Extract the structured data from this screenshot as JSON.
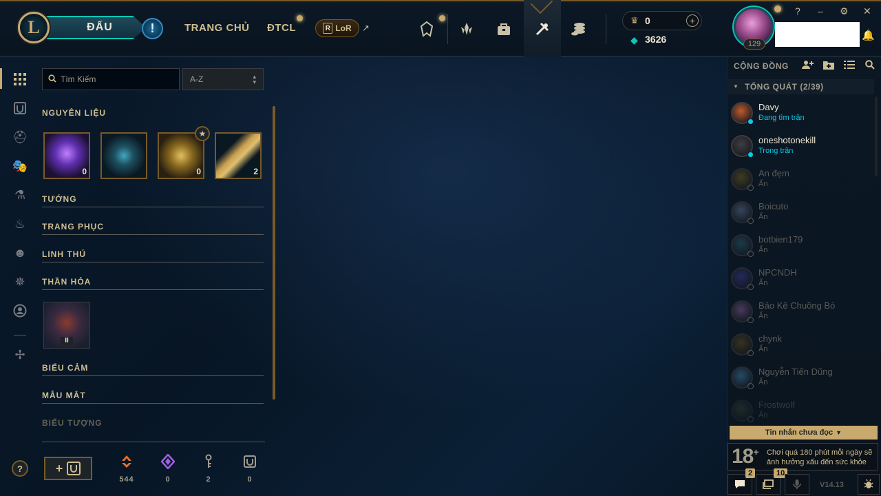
{
  "nav": {
    "play_label": "ĐẤU",
    "home_label": "TRANG CHỦ",
    "tft_label": "ĐTCL",
    "lor_label": "LoR",
    "lor_badge": "R",
    "external_arrow": "↗",
    "rp_value": "0",
    "be_value": "3626",
    "level": "129",
    "window": {
      "help": "?",
      "minimize": "–",
      "settings": "⚙",
      "close": "✕"
    },
    "icons": [
      "shop-crest-icon",
      "tft-icon",
      "collection-bag-icon",
      "loot-hextech-icon",
      "currency-stack-icon"
    ]
  },
  "rail": {
    "items": [
      "grid-icon",
      "champion-shield-icon",
      "helmet-icon",
      "mask-icon",
      "potion-icon",
      "flame-icon",
      "emote-smile-icon",
      "sparkle-icon",
      "profile-icon",
      "ward-icon"
    ],
    "help": "?"
  },
  "collection": {
    "search_placeholder": "Tìm Kiếm",
    "sort_label": "A-Z",
    "sections": {
      "materials": "NGUYÊN LIỆU",
      "champions": "TƯỚNG",
      "skins": "TRANG PHỤC",
      "companions": "LINH THÚ",
      "wards": "THẦN HỎA",
      "emotes": "BIỂU CẢM",
      "eyes": "MẪU MẮT",
      "icons": "BIỂU TƯỢNG"
    },
    "materials": [
      {
        "name": "mythic-essence-crystal",
        "count": "0"
      },
      {
        "name": "lantern-orb",
        "count": ""
      },
      {
        "name": "hextech-chest",
        "count": "0"
      },
      {
        "name": "hextech-key",
        "count": "2"
      }
    ],
    "ward_tier": "II",
    "resources": [
      {
        "name": "orange-essence-icon",
        "value": "544",
        "color": "#e8702a"
      },
      {
        "name": "mythic-essence-icon",
        "value": "0",
        "color": "#a060e0"
      },
      {
        "name": "key-fragment-icon",
        "value": "2",
        "color": "#a09b8c"
      },
      {
        "name": "champion-token-icon",
        "value": "0",
        "color": "#a09b8c"
      }
    ]
  },
  "social": {
    "title": "CỘNG ĐỒNG",
    "group": "TỔNG QUÁT (2/39)",
    "friends": [
      {
        "name": "Davy",
        "status": "Đang tìm trận",
        "state": "online"
      },
      {
        "name": "oneshotonekill",
        "status": "Trong trận",
        "state": "online"
      },
      {
        "name": "An đẹm",
        "status": "Ẩn",
        "state": "offline"
      },
      {
        "name": "Boicuto",
        "status": "Ẩn",
        "state": "offline"
      },
      {
        "name": "botbien179",
        "status": "Ẩn",
        "state": "offline"
      },
      {
        "name": "NPCNDH",
        "status": "Ẩn",
        "state": "offline"
      },
      {
        "name": "Bảo Kê Chuồng Bò",
        "status": "Ẩn",
        "state": "offline"
      },
      {
        "name": "chynk",
        "status": "Ẩn",
        "state": "offline"
      },
      {
        "name": "Nguyễn Tiến Dũng",
        "status": "Ẩn",
        "state": "offline"
      },
      {
        "name": "Frostwolf",
        "status": "Ẩn",
        "state": "offline"
      }
    ],
    "unread_label": "Tin nhắn chưa đọc",
    "age_rating": "18",
    "age_plus": "+",
    "health_warning": "Chơi quá 180 phút mỗi ngày sẽ ảnh hưởng xấu đến sức khỏe",
    "chat_badge": "2",
    "tasks_badge": "10",
    "version": "V14.13"
  },
  "colors": {
    "gold": "#c8aa6e",
    "gold_dark": "#785a28",
    "teal": "#0ac8b9",
    "online_name": "#f0e6d2",
    "online_status": "#0acbe6",
    "offline": "#5b5a56"
  }
}
